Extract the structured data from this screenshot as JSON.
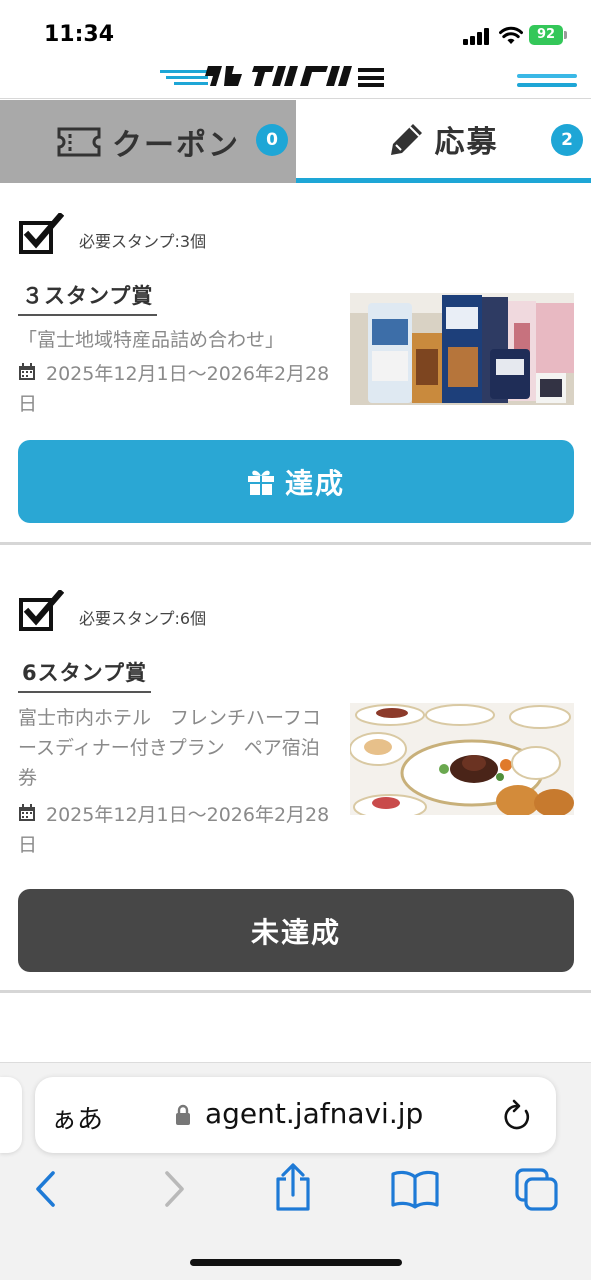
{
  "status_bar": {
    "time": "11:34",
    "battery": "92",
    "icons": [
      "signal-icon",
      "wifi-icon",
      "battery-icon"
    ]
  },
  "header": {
    "icons": [
      "logo",
      "menu-icon"
    ]
  },
  "tabs": [
    {
      "label": "クーポン",
      "badge": "0",
      "icon": "ticket-icon",
      "active": false
    },
    {
      "label": "応募",
      "badge": "2",
      "icon": "pencil-icon",
      "active": true
    }
  ],
  "prizes": [
    {
      "stamp_requirement": "必要スタンプ:3個",
      "title": "３スタンプ賞",
      "description": "「富士地域特産品詰め合わせ」",
      "period": "2025年12月1日～2026年2月28日",
      "button_label": "達成",
      "status": "achieved"
    },
    {
      "stamp_requirement": "必要スタンプ:6個",
      "title": "6スタンプ賞",
      "description": "富士市内ホテル　フレンチハーフコースディナー付きプラン　ペア宿泊券",
      "period": "2025年12月1日～2026年2月28日",
      "button_label": "未達成",
      "status": "unachieved"
    }
  ],
  "browser": {
    "aa_label": "ぁあ",
    "url": "agent.jafnavi.jp",
    "toolbar_icons": [
      "back-icon",
      "forward-icon",
      "share-icon",
      "bookmarks-icon",
      "tabs-icon"
    ]
  },
  "colors": {
    "accent": "#1ea6d6",
    "achieved_button": "#2aa7d4",
    "unachieved_button": "#474747",
    "inactive_tab": "#a9a9a9",
    "battery": "#34c759"
  }
}
